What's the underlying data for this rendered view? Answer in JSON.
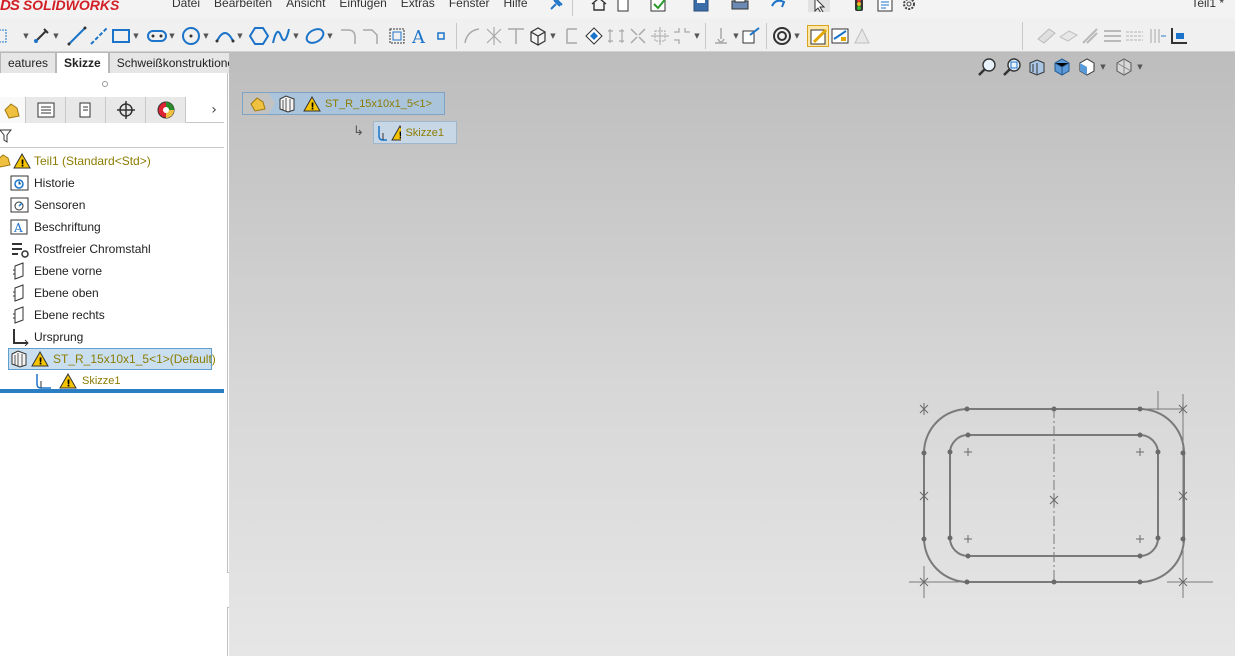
{
  "app": {
    "brand_ds": "DS",
    "brand_name": "SOLIDWORKS",
    "document_title": "Teil1 *"
  },
  "menu": [
    "Datei",
    "Bearbeiten",
    "Ansicht",
    "Einfügen",
    "Extras",
    "Fenster",
    "Hilfe"
  ],
  "commandmanager_tabs": [
    {
      "label": "eatures",
      "active": false
    },
    {
      "label": "Skizze",
      "active": true
    },
    {
      "label": "Schweißkonstruktionen",
      "active": false
    }
  ],
  "tree": {
    "root": "Teil1  (Standard<Std>)",
    "items": [
      {
        "label": "Historie",
        "icon": "history-icon"
      },
      {
        "label": "Sensoren",
        "icon": "sensor-icon"
      },
      {
        "label": "Beschriftung",
        "icon": "annotation-icon"
      },
      {
        "label": "Rostfreier Chromstahl",
        "icon": "material-icon"
      },
      {
        "label": "Ebene vorne",
        "icon": "plane-icon"
      },
      {
        "label": "Ebene oben",
        "icon": "plane-icon"
      },
      {
        "label": "Ebene rechts",
        "icon": "plane-icon"
      },
      {
        "label": "Ursprung",
        "icon": "origin-icon"
      }
    ],
    "feature": "ST_R_15x10x1_5<1>(Default)",
    "sketch": "Skizze1"
  },
  "breadcrumb": {
    "feature": "ST_R_15x10x1_5<1>",
    "sketch": "Skizze1"
  },
  "colors": {
    "accent": "#2a7fc4",
    "warning": "#f5c400",
    "warning_text": "#8c7c00",
    "brand": "#d21f26"
  }
}
